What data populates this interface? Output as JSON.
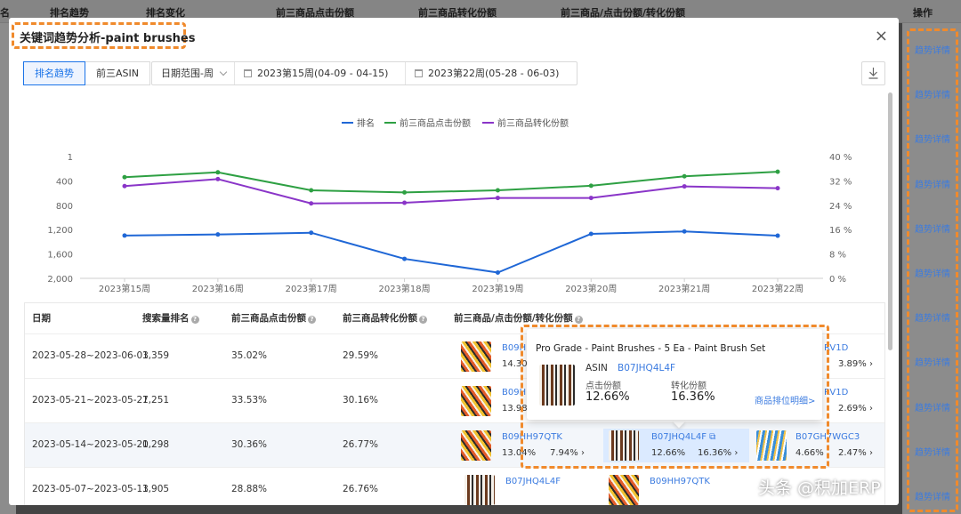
{
  "background": {
    "headers": [
      "名",
      "排名趋势",
      "排名变化",
      "前三商品点击份额",
      "前三商品转化份额",
      "前三商品/点击份额/转化份额",
      "操作"
    ],
    "ops_link": "趋势详情",
    "ops_rows": 11
  },
  "modal": {
    "title": "关键词趋势分析-paint brushes",
    "close": "×",
    "tabs": [
      "排名趋势",
      "前三ASIN"
    ],
    "period_label": "日期范围-周",
    "date_start": "2023第15周(04-09 - 04-15)",
    "date_end": "2023第22周(05-28 - 06-03)"
  },
  "chart_data": {
    "type": "line",
    "categories": [
      "2023第15周",
      "2023第16周",
      "2023第17周",
      "2023第18周",
      "2023第19周",
      "2023第20周",
      "2023第21周",
      "2023第22周"
    ],
    "series": [
      {
        "name": "排名",
        "axis": "left",
        "color": "#1f67d6",
        "values": [
          1298,
          1280,
          1251,
          1680,
          1905,
          1270,
          1230,
          1300
        ]
      },
      {
        "name": "前三商品点击份额",
        "axis": "right",
        "color": "#2ea043",
        "values": [
          33.2,
          34.8,
          28.9,
          28.2,
          28.9,
          30.4,
          33.5,
          35.0
        ]
      },
      {
        "name": "前三商品转化份额",
        "axis": "right",
        "color": "#8a35c8",
        "values": [
          30.3,
          32.6,
          24.6,
          24.8,
          26.4,
          26.4,
          30.2,
          29.6
        ]
      }
    ],
    "left_axis": {
      "ticks": [
        "1",
        "400",
        "800",
        "1,200",
        "1,600",
        "2,000"
      ],
      "range": [
        0,
        2000
      ],
      "inverted": true
    },
    "right_axis": {
      "ticks": [
        "40 %",
        "32 %",
        "24 %",
        "16 %",
        "8 %",
        "0 %"
      ],
      "range": [
        0,
        40
      ]
    },
    "legend_position": "top"
  },
  "table": {
    "headers": [
      "日期",
      "搜索量排名",
      "前三商品点击份额",
      "前三商品转化份额",
      "前三商品/点击份额/转化份额"
    ],
    "rows": [
      {
        "date": "2023-05-28~2023-06-03",
        "rank": "1,359",
        "click": "35.02%",
        "conv": "29.59%",
        "a1": "B09HH",
        "a1_pct": "14.30",
        "a3": "RV1D",
        "a3_conv": "3.89%"
      },
      {
        "date": "2023-05-21~2023-05-27",
        "rank": "1,251",
        "click": "33.53%",
        "conv": "30.16%",
        "a1": "B09HH",
        "a1_pct": "13.98",
        "a3": "RV1D",
        "a3_conv": "2.69%"
      },
      {
        "date": "2023-05-14~2023-05-20",
        "rank": "1,298",
        "click": "30.36%",
        "conv": "26.77%",
        "a1": "B09HH97QTK",
        "a1_click": "13.04%",
        "a1_conv": "7.94%",
        "a2": "B07JHQ4L4F",
        "a2_click": "12.66%",
        "a2_conv": "16.36%",
        "a3": "B07GH7WGC3",
        "a3_click": "4.66%",
        "a3_conv": "2.47%"
      },
      {
        "date": "2023-05-07~2023-05-13",
        "rank": "1,905",
        "click": "28.88%",
        "conv": "26.76%",
        "a1": "B07JHQ4L4F",
        "a2": "B09HH97QTK"
      }
    ]
  },
  "popover": {
    "title": "Pro Grade - Paint Brushes - 5 Ea - Paint Brush Set",
    "asin_label": "ASIN",
    "asin": "B07JHQ4L4F",
    "click_label": "点击份额",
    "click_value": "12.66%",
    "conv_label": "转化份额",
    "conv_value": "16.36%",
    "detail_link": "商品排位明细>"
  },
  "watermark": "头条 @积加ERP"
}
